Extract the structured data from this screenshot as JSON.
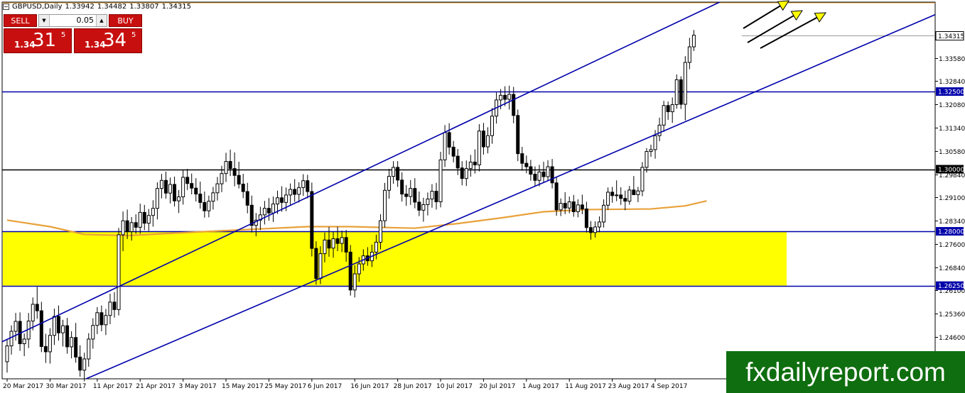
{
  "header": {
    "symbol": "GBPUSD,Daily",
    "open": "1.33942",
    "high": "1.34482",
    "low": "1.33807",
    "close": "1.34315"
  },
  "trade_panel": {
    "sell_label": "SELL",
    "buy_label": "BUY",
    "lot_value": "0.05",
    "sell_quote": {
      "prefix": "1.34",
      "big": "31",
      "sup": "5"
    },
    "buy_quote": {
      "prefix": "1.34",
      "big": "34",
      "sup": "5"
    }
  },
  "watermark": "fxdailyreport.com",
  "colors": {
    "bull_body": "#ffffff",
    "bear_body": "#000000",
    "channel_line": "#0000aa",
    "ma_line": "#e8a13a",
    "support_zone": "#ffff00",
    "arrow_fill": "#ffff00",
    "trade_red": "#c80f0f",
    "brand_green": "#0f6e0f"
  },
  "chart_data": {
    "type": "candlestick",
    "ylim": [
      1.2325,
      1.3538
    ],
    "y_ticks": [
      1.3358,
      1.3284,
      1.3208,
      1.3134,
      1.3058,
      1.2984,
      1.291,
      1.2834,
      1.276,
      1.2684,
      1.261,
      1.2536,
      1.246
    ],
    "y_tick_labels": [
      "1.33580",
      "1.32840",
      "1.32080",
      "1.31340",
      "1.30580",
      "1.29840",
      "1.29100",
      "1.28340",
      "1.27600",
      "1.26840",
      "1.26100",
      "1.25360",
      "1.24600"
    ],
    "x_labels": [
      "20 Mar 2017",
      "30 Mar 2017",
      "11 Apr 2017",
      "21 Apr 2017",
      "3 May 2017",
      "15 May 2017",
      "25 May 2017",
      "6 Jun 2017",
      "16 Jun 2017",
      "28 Jun 2017",
      "10 Jul 2017",
      "20 Jul 2017",
      "1 Aug 2017",
      "11 Aug 2017",
      "23 Aug 2017",
      "4 Sep 2017"
    ],
    "level_lines": [
      {
        "price": 1.325,
        "label": "1.32500",
        "color": "#0000aa"
      },
      {
        "price": 1.3,
        "label": "1.30000",
        "color": "#000000"
      },
      {
        "price": 1.28,
        "label": "1.28000",
        "color": "#0000aa"
      },
      {
        "price": 1.2625,
        "label": "1.26250",
        "color": "#0000aa"
      }
    ],
    "current_price": {
      "price": 1.34315,
      "label": "1.34315"
    },
    "support_zone": {
      "top": 1.28,
      "bottom": 1.2625
    },
    "channel_upper": [
      {
        "bar": 0,
        "price": 1.2452
      },
      {
        "bar": 166,
        "price": 1.3538
      }
    ],
    "channel_lower": [
      {
        "bar": 0,
        "price": 1.2216
      },
      {
        "bar": 223,
        "price": 1.3538
      }
    ],
    "moving_average": [
      {
        "bar": 0,
        "price": 1.2836
      },
      {
        "bar": 10,
        "price": 1.2815
      },
      {
        "bar": 18,
        "price": 1.279
      },
      {
        "bar": 28,
        "price": 1.2786
      },
      {
        "bar": 40,
        "price": 1.2795
      },
      {
        "bar": 55,
        "price": 1.2805
      },
      {
        "bar": 70,
        "price": 1.2815
      },
      {
        "bar": 80,
        "price": 1.2815
      },
      {
        "bar": 95,
        "price": 1.281
      },
      {
        "bar": 105,
        "price": 1.2825
      },
      {
        "bar": 115,
        "price": 1.2843
      },
      {
        "bar": 125,
        "price": 1.2863
      },
      {
        "bar": 135,
        "price": 1.287
      },
      {
        "bar": 150,
        "price": 1.2872
      },
      {
        "bar": 158,
        "price": 1.2882
      },
      {
        "bar": 163,
        "price": 1.2898
      }
    ],
    "candles": [
      [
        1.238,
        1.245,
        1.2345,
        1.2431
      ],
      [
        1.2431,
        1.2497,
        1.2403,
        1.2478
      ],
      [
        1.2478,
        1.2537,
        1.2448,
        1.251
      ],
      [
        1.251,
        1.2539,
        1.2415,
        1.2438
      ],
      [
        1.2438,
        1.2471,
        1.2398,
        1.2453
      ],
      [
        1.2453,
        1.2537,
        1.2424,
        1.2511
      ],
      [
        1.2511,
        1.2587,
        1.2481,
        1.2565
      ],
      [
        1.2565,
        1.2621,
        1.2518,
        1.2544
      ],
      [
        1.2544,
        1.2573,
        1.2411,
        1.2429
      ],
      [
        1.2429,
        1.247,
        1.2376,
        1.2412
      ],
      [
        1.2412,
        1.2488,
        1.2374,
        1.2465
      ],
      [
        1.2465,
        1.2551,
        1.2434,
        1.2526
      ],
      [
        1.2526,
        1.2561,
        1.2448,
        1.2473
      ],
      [
        1.2473,
        1.2515,
        1.2429,
        1.2496
      ],
      [
        1.2496,
        1.2521,
        1.2406,
        1.2428
      ],
      [
        1.2428,
        1.2478,
        1.2391,
        1.2458
      ],
      [
        1.2458,
        1.2505,
        1.2377,
        1.2395
      ],
      [
        1.2395,
        1.2433,
        1.2332,
        1.2353
      ],
      [
        1.2353,
        1.2409,
        1.2317,
        1.2389
      ],
      [
        1.2389,
        1.2472,
        1.2364,
        1.2453
      ],
      [
        1.2453,
        1.252,
        1.2422,
        1.2497
      ],
      [
        1.2497,
        1.2556,
        1.2469,
        1.2538
      ],
      [
        1.2538,
        1.2561,
        1.2478,
        1.2499
      ],
      [
        1.2499,
        1.255,
        1.2466,
        1.2529
      ],
      [
        1.2529,
        1.2599,
        1.2501,
        1.2572
      ],
      [
        1.2572,
        1.2604,
        1.2522,
        1.2548
      ],
      [
        1.2548,
        1.2811,
        1.2529,
        1.2789
      ],
      [
        1.2789,
        1.2864,
        1.2736,
        1.2834
      ],
      [
        1.2834,
        1.287,
        1.2775,
        1.2799
      ],
      [
        1.2799,
        1.2846,
        1.277,
        1.2828
      ],
      [
        1.2828,
        1.2855,
        1.2792,
        1.2813
      ],
      [
        1.2813,
        1.2889,
        1.2792,
        1.2861
      ],
      [
        1.2861,
        1.2885,
        1.2804,
        1.2826
      ],
      [
        1.2826,
        1.2872,
        1.2801,
        1.2851
      ],
      [
        1.2851,
        1.29,
        1.2815,
        1.2874
      ],
      [
        1.2874,
        1.2958,
        1.2838,
        1.2938
      ],
      [
        1.2938,
        1.2985,
        1.2906,
        1.2964
      ],
      [
        1.2964,
        1.2992,
        1.2905,
        1.2923
      ],
      [
        1.2923,
        1.2973,
        1.289,
        1.2951
      ],
      [
        1.2951,
        1.2976,
        1.288,
        1.2898
      ],
      [
        1.2898,
        1.2933,
        1.2859,
        1.2911
      ],
      [
        1.2911,
        1.2998,
        1.2886,
        1.2974
      ],
      [
        1.2974,
        1.3001,
        1.2933,
        1.2954
      ],
      [
        1.2954,
        1.2986,
        1.2919,
        1.2939
      ],
      [
        1.2939,
        1.2971,
        1.2896,
        1.292
      ],
      [
        1.292,
        1.296,
        1.2873,
        1.2893
      ],
      [
        1.2893,
        1.2928,
        1.2844,
        1.2866
      ],
      [
        1.2866,
        1.2915,
        1.2845,
        1.2897
      ],
      [
        1.2897,
        1.2943,
        1.287,
        1.2924
      ],
      [
        1.2924,
        1.2975,
        1.2899,
        1.2953
      ],
      [
        1.2953,
        1.3011,
        1.2926,
        1.2986
      ],
      [
        1.2986,
        1.3053,
        1.2959,
        1.3025
      ],
      [
        1.3025,
        1.3063,
        1.2978,
        1.3002
      ],
      [
        1.3002,
        1.3054,
        1.2945,
        1.298
      ],
      [
        1.298,
        1.3024,
        1.2938,
        1.2952
      ],
      [
        1.2952,
        1.2985,
        1.2907,
        1.2928
      ],
      [
        1.2928,
        1.2956,
        1.2858,
        1.2884
      ],
      [
        1.2884,
        1.2915,
        1.2796,
        1.2819
      ],
      [
        1.2819,
        1.2859,
        1.2784,
        1.2836
      ],
      [
        1.2836,
        1.2879,
        1.2804,
        1.2853
      ],
      [
        1.2853,
        1.2898,
        1.2822,
        1.2874
      ],
      [
        1.2874,
        1.2907,
        1.2834,
        1.2859
      ],
      [
        1.2859,
        1.2912,
        1.283,
        1.2888
      ],
      [
        1.2888,
        1.2931,
        1.2856,
        1.2908
      ],
      [
        1.2908,
        1.2945,
        1.2863,
        1.2893
      ],
      [
        1.2893,
        1.2941,
        1.2865,
        1.2917
      ],
      [
        1.2917,
        1.2954,
        1.2882,
        1.2935
      ],
      [
        1.2935,
        1.2968,
        1.2895,
        1.2919
      ],
      [
        1.2919,
        1.2958,
        1.2893,
        1.2941
      ],
      [
        1.2941,
        1.2984,
        1.2914,
        1.2963
      ],
      [
        1.2963,
        1.2982,
        1.2906,
        1.2928
      ],
      [
        1.2928,
        1.2957,
        1.2719,
        1.2745
      ],
      [
        1.2745,
        1.2768,
        1.2628,
        1.2648
      ],
      [
        1.2648,
        1.2752,
        1.263,
        1.2728
      ],
      [
        1.2728,
        1.2796,
        1.27,
        1.2772
      ],
      [
        1.2772,
        1.2814,
        1.2718,
        1.2746
      ],
      [
        1.2746,
        1.2799,
        1.2715,
        1.2776
      ],
      [
        1.2776,
        1.2815,
        1.2736,
        1.2761
      ],
      [
        1.2761,
        1.2802,
        1.2733,
        1.278
      ],
      [
        1.278,
        1.2804,
        1.2702,
        1.2733
      ],
      [
        1.2733,
        1.2756,
        1.2593,
        1.2611
      ],
      [
        1.2611,
        1.2691,
        1.2587,
        1.2663
      ],
      [
        1.2663,
        1.2717,
        1.2637,
        1.2695
      ],
      [
        1.2695,
        1.2742,
        1.2673,
        1.2721
      ],
      [
        1.2721,
        1.2749,
        1.2689,
        1.2705
      ],
      [
        1.2705,
        1.2757,
        1.2685,
        1.2733
      ],
      [
        1.2733,
        1.2789,
        1.271,
        1.2765
      ],
      [
        1.2765,
        1.2855,
        1.2742,
        1.2834
      ],
      [
        1.2834,
        1.2956,
        1.2812,
        1.2932
      ],
      [
        1.2932,
        1.3001,
        1.2905,
        1.2977
      ],
      [
        1.2977,
        1.3026,
        1.2953,
        1.3006
      ],
      [
        1.3006,
        1.3026,
        1.2943,
        1.2965
      ],
      [
        1.2965,
        1.299,
        1.2896,
        1.292
      ],
      [
        1.292,
        1.2949,
        1.2882,
        1.2912
      ],
      [
        1.2912,
        1.2965,
        1.2885,
        1.2938
      ],
      [
        1.2938,
        1.2971,
        1.2874,
        1.2894
      ],
      [
        1.2894,
        1.2928,
        1.2849,
        1.2868
      ],
      [
        1.2868,
        1.2908,
        1.2831,
        1.2886
      ],
      [
        1.2886,
        1.2925,
        1.2851,
        1.2904
      ],
      [
        1.2904,
        1.2952,
        1.2876,
        1.2929
      ],
      [
        1.2929,
        1.2956,
        1.287,
        1.2895
      ],
      [
        1.2895,
        1.3056,
        1.2877,
        1.303
      ],
      [
        1.303,
        1.3142,
        1.3007,
        1.3118
      ],
      [
        1.3118,
        1.3148,
        1.3047,
        1.3071
      ],
      [
        1.3071,
        1.3091,
        1.3022,
        1.3042
      ],
      [
        1.3042,
        1.3065,
        1.2981,
        1.3004
      ],
      [
        1.3004,
        1.3026,
        1.2948,
        1.297
      ],
      [
        1.297,
        1.3028,
        1.2946,
        1.3002
      ],
      [
        1.3002,
        1.3046,
        1.2976,
        1.3023
      ],
      [
        1.3023,
        1.3064,
        1.2986,
        1.3014
      ],
      [
        1.3014,
        1.3145,
        1.2993,
        1.3123
      ],
      [
        1.3123,
        1.3149,
        1.3047,
        1.3072
      ],
      [
        1.3072,
        1.3135,
        1.3051,
        1.3108
      ],
      [
        1.3108,
        1.3197,
        1.3082,
        1.3171
      ],
      [
        1.3171,
        1.3247,
        1.3147,
        1.3223
      ],
      [
        1.3223,
        1.3258,
        1.3193,
        1.3238
      ],
      [
        1.3238,
        1.3267,
        1.3203,
        1.3225
      ],
      [
        1.3225,
        1.3269,
        1.3192,
        1.3241
      ],
      [
        1.3241,
        1.3265,
        1.3148,
        1.3173
      ],
      [
        1.3173,
        1.3192,
        1.3026,
        1.305
      ],
      [
        1.305,
        1.3072,
        1.2995,
        1.3019
      ],
      [
        1.3019,
        1.3044,
        1.2987,
        1.3008
      ],
      [
        1.3008,
        1.303,
        1.2963,
        1.2984
      ],
      [
        1.2984,
        1.3009,
        1.2944,
        1.2964
      ],
      [
        1.2964,
        1.3014,
        1.2945,
        1.2991
      ],
      [
        1.2991,
        1.3024,
        1.2957,
        1.2976
      ],
      [
        1.2976,
        1.3029,
        1.2962,
        1.3008
      ],
      [
        1.3008,
        1.3033,
        1.2938,
        1.2956
      ],
      [
        1.2956,
        1.2975,
        1.285,
        1.2869
      ],
      [
        1.2869,
        1.2906,
        1.2849,
        1.289
      ],
      [
        1.289,
        1.2926,
        1.2855,
        1.2875
      ],
      [
        1.2875,
        1.2912,
        1.2858,
        1.2895
      ],
      [
        1.2895,
        1.2917,
        1.2847,
        1.2863
      ],
      [
        1.2863,
        1.2903,
        1.2845,
        1.2885
      ],
      [
        1.2885,
        1.2918,
        1.2855,
        1.2872
      ],
      [
        1.2872,
        1.2895,
        1.2796,
        1.2812
      ],
      [
        1.2812,
        1.2833,
        1.2773,
        1.2796
      ],
      [
        1.2796,
        1.2832,
        1.278,
        1.2814
      ],
      [
        1.2814,
        1.2848,
        1.2797,
        1.283
      ],
      [
        1.283,
        1.2903,
        1.2812,
        1.2884
      ],
      [
        1.2884,
        1.2941,
        1.2869,
        1.2926
      ],
      [
        1.2926,
        1.2943,
        1.2892,
        1.2915
      ],
      [
        1.2915,
        1.2964,
        1.2897,
        1.2917
      ],
      [
        1.2917,
        1.2942,
        1.2885,
        1.2906
      ],
      [
        1.2906,
        1.2931,
        1.2868,
        1.2897
      ],
      [
        1.2897,
        1.2946,
        1.2886,
        1.2933
      ],
      [
        1.2933,
        1.2978,
        1.2917,
        1.2918
      ],
      [
        1.2918,
        1.2943,
        1.2894,
        1.293
      ],
      [
        1.293,
        1.3023,
        1.2913,
        1.3006
      ],
      [
        1.3006,
        1.3068,
        1.2989,
        1.3057
      ],
      [
        1.3057,
        1.3079,
        1.304,
        1.3063
      ],
      [
        1.3063,
        1.3126,
        1.3034,
        1.3108
      ],
      [
        1.3108,
        1.3166,
        1.309,
        1.3142
      ],
      [
        1.3142,
        1.322,
        1.312,
        1.3205
      ],
      [
        1.3205,
        1.3218,
        1.3159,
        1.3185
      ],
      [
        1.3185,
        1.3231,
        1.3149,
        1.3208
      ],
      [
        1.3208,
        1.3305,
        1.3195,
        1.3288
      ],
      [
        1.3288,
        1.3299,
        1.3194,
        1.3209
      ],
      [
        1.3209,
        1.3364,
        1.3157,
        1.3344
      ],
      [
        1.3344,
        1.3423,
        1.3322,
        1.3394
      ],
      [
        1.3394,
        1.34482,
        1.33807,
        1.34315
      ]
    ]
  }
}
